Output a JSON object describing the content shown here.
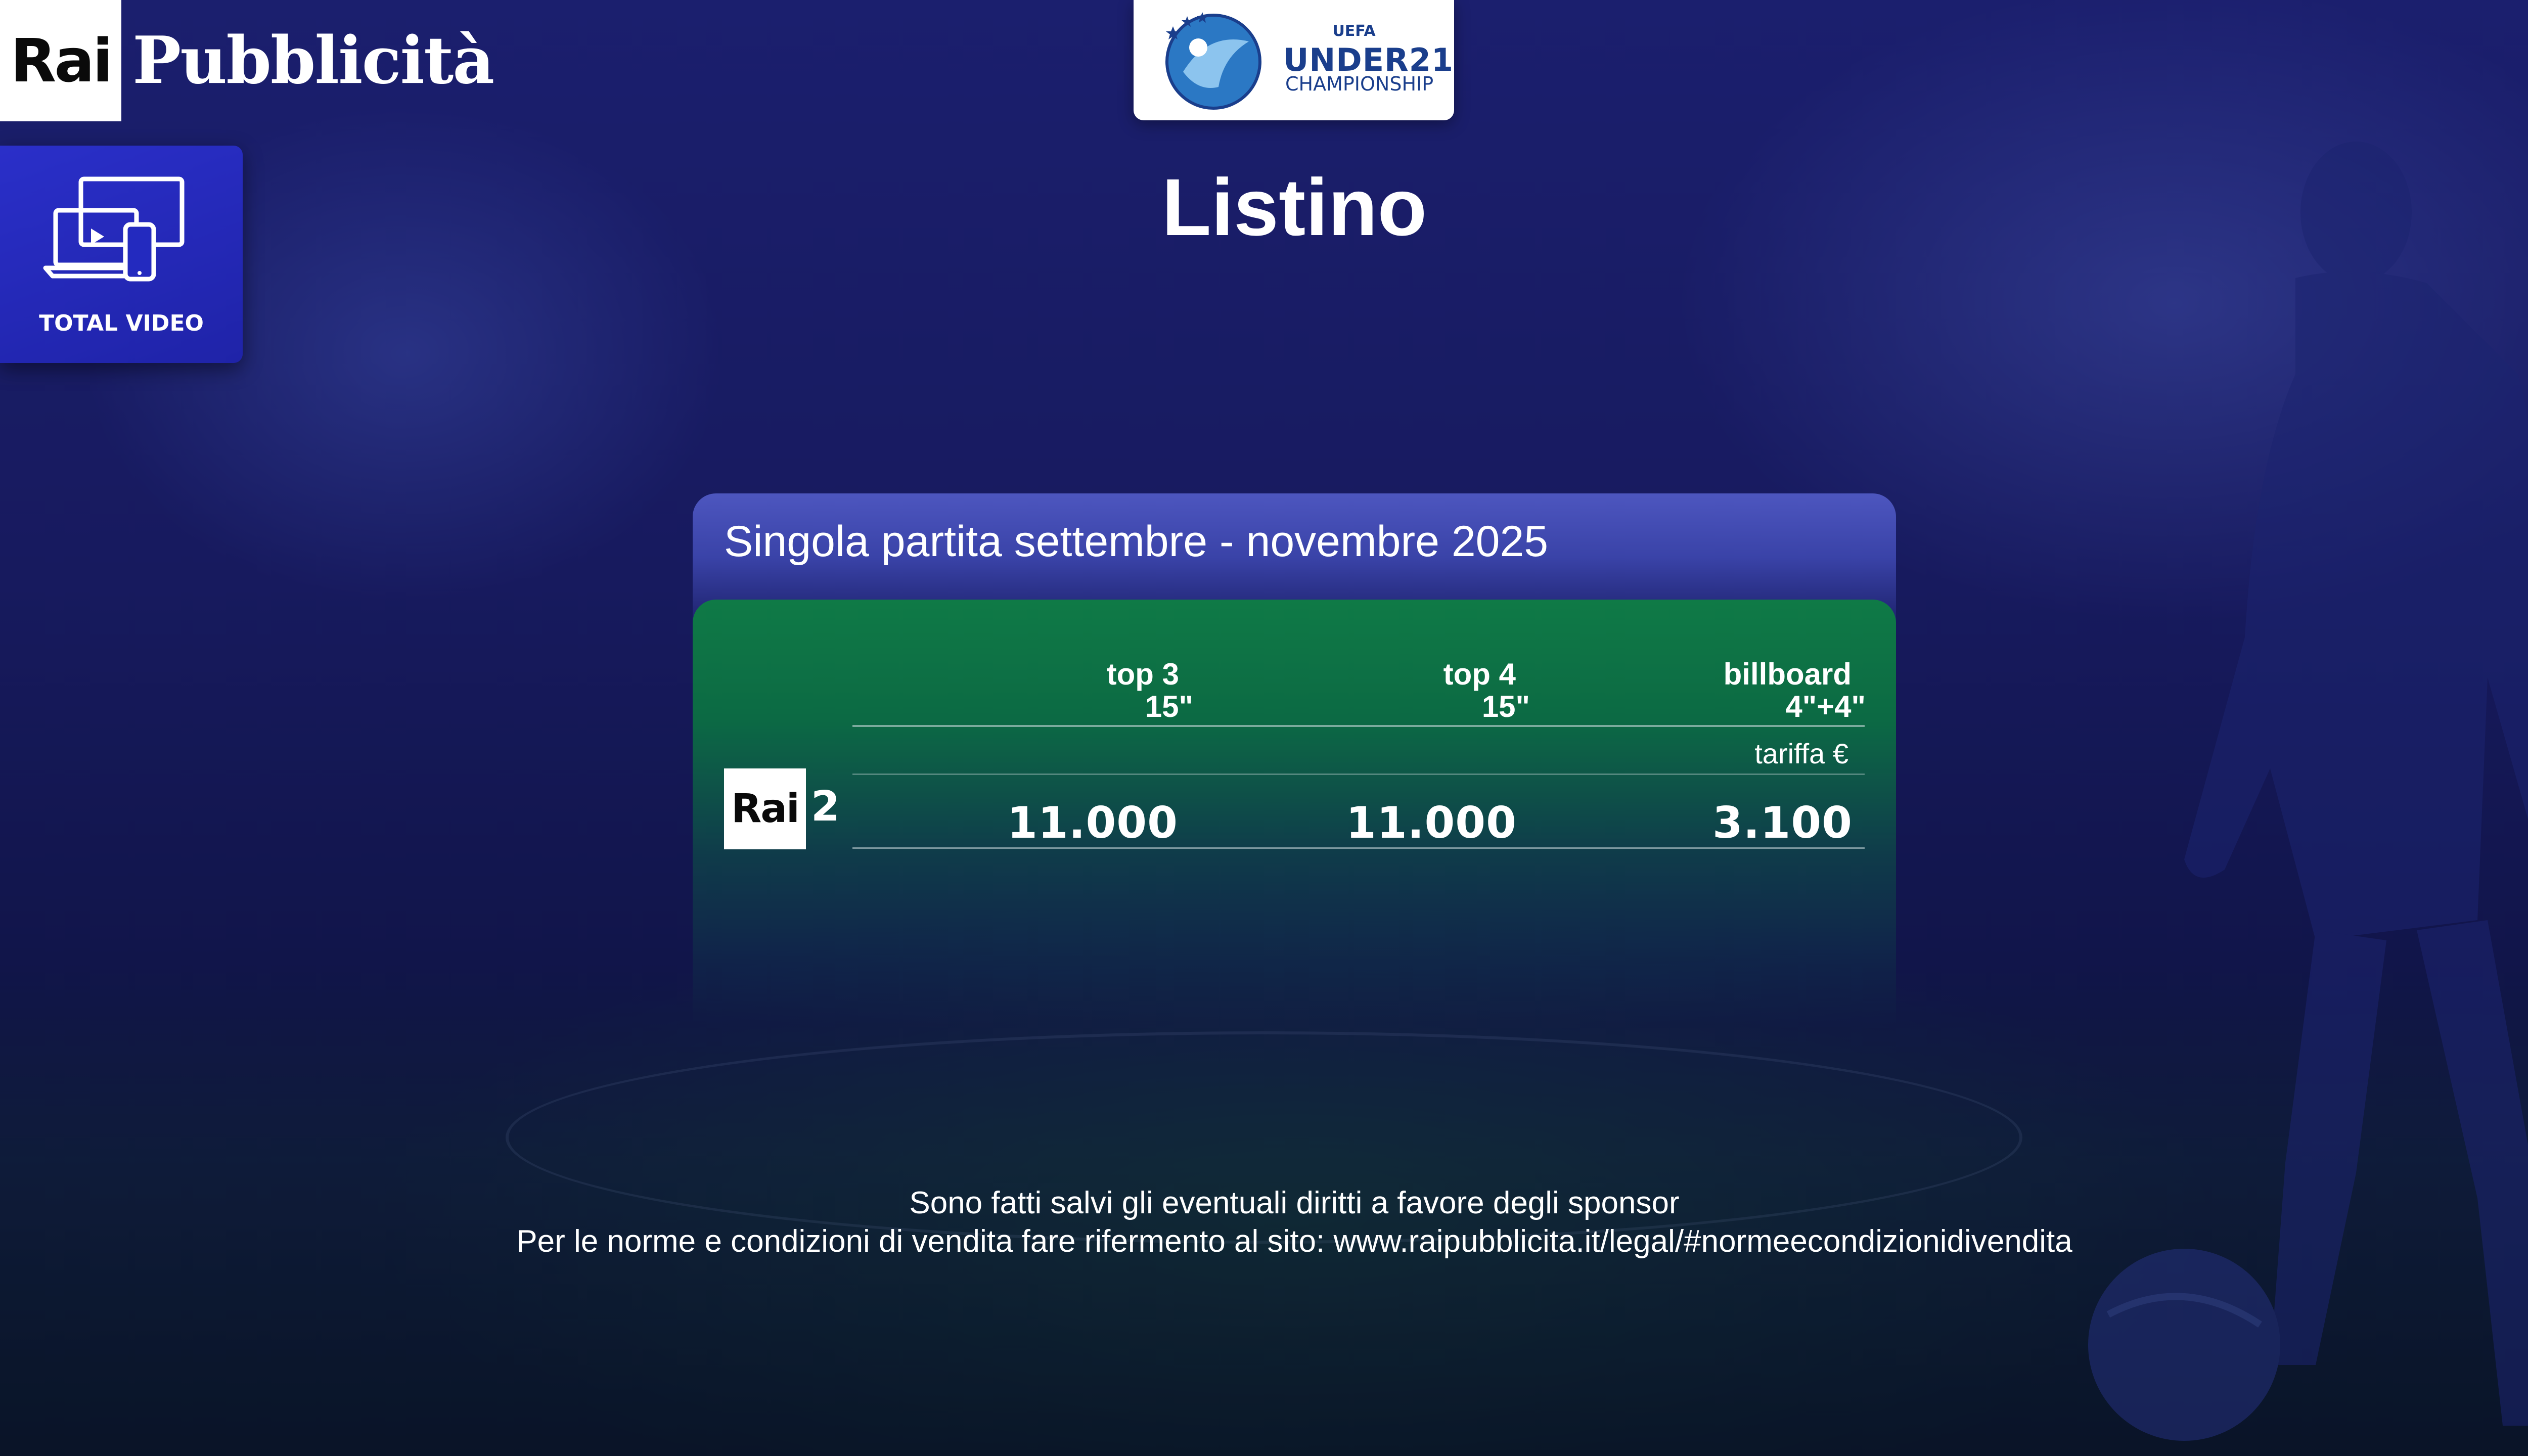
{
  "brand": {
    "rai_logo": "Rai",
    "name": "Pubblicità"
  },
  "badge": {
    "label": "TOTAL VIDEO",
    "icon": "devices-icon"
  },
  "event_logo": {
    "top_text": "UEFA",
    "main_text": "UNDER21",
    "sub_text": "CHAMPIONSHIP"
  },
  "title": "Listino",
  "panel": {
    "heading": "Singola partita settembre - novembre 2025",
    "columns": [
      {
        "line1": "top 3",
        "line2": "15\""
      },
      {
        "line1": "top 4",
        "line2": "15\""
      },
      {
        "line1": "billboard",
        "line2": "4\"+4\""
      }
    ],
    "tariff_label": "tariffa €",
    "rows": [
      {
        "channel_logo": "Rai",
        "channel_number": "2",
        "values": [
          "11.000",
          "11.000",
          "3.100"
        ]
      }
    ]
  },
  "footer": {
    "line1": "Sono fatti salvi gli eventuali diritti a favore degli sponsor",
    "line2": "Per le norme e condizioni di vendita fare rifermento al sito: www.raipubblicita.it/legal/#normeecondizionidivendita"
  },
  "colors": {
    "background": "#171a5e",
    "panel_header": "#3a43a8",
    "panel_body": "#0f7a46",
    "badge": "#2a2fc9",
    "event_blue": "#1a3e8c"
  }
}
